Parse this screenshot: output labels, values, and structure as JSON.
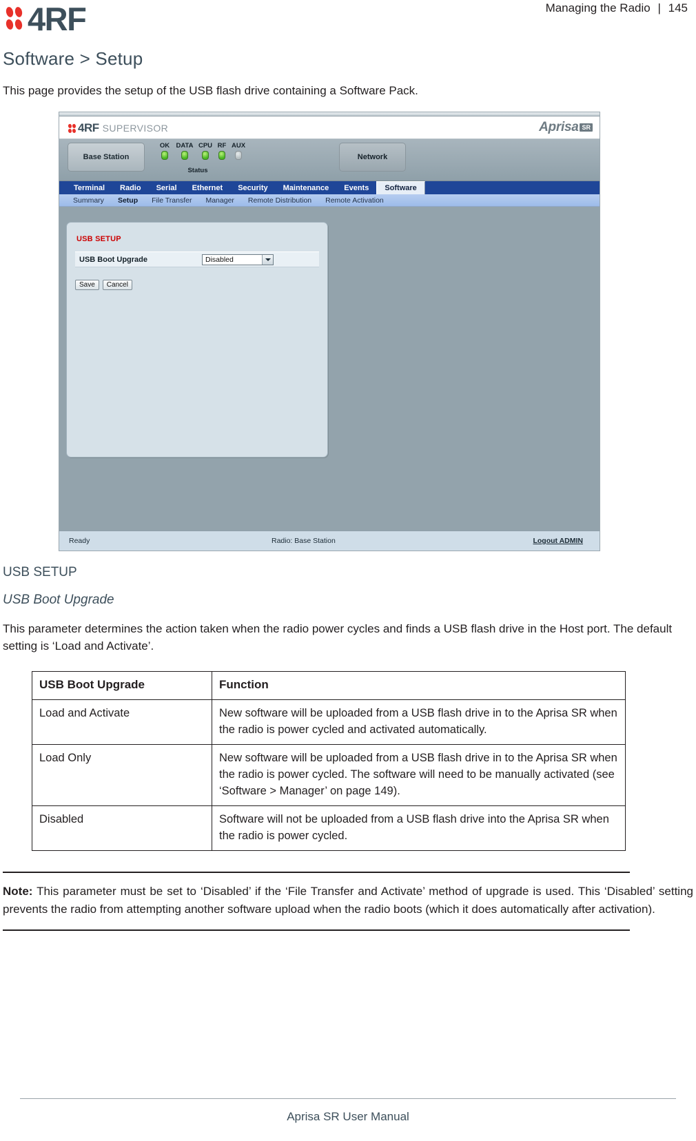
{
  "header": {
    "brand_word": "4RF",
    "running_head": "Managing the Radio",
    "separator": "|",
    "page_number": "145"
  },
  "page": {
    "title": "Software > Setup",
    "intro": "This page provides the setup of the USB flash drive containing a Software Pack.",
    "section_heading": "USB SETUP",
    "parameter_heading": "USB Boot Upgrade",
    "parameter_description": "This parameter determines the action taken when the radio power cycles and finds a USB flash drive in the Host port. The default setting is ‘Load and Activate’.",
    "note_label": "Note:",
    "note_text": "This parameter must be set to ‘Disabled’ if the ‘File Transfer and Activate’ method of upgrade is used. This ‘Disabled’ setting prevents the radio from attempting another software upload when the radio boots (which it does automatically after activation)."
  },
  "screenshot": {
    "brand": {
      "name": "4RF",
      "product": "SUPERVISOR",
      "right_logo": "Aprisa",
      "right_logo_badge": "SR"
    },
    "station_button": "Base Station",
    "network_button": "Network",
    "status_caption": "Status",
    "leds": [
      {
        "label": "OK",
        "state": "green"
      },
      {
        "label": "DATA",
        "state": "green"
      },
      {
        "label": "CPU",
        "state": "green"
      },
      {
        "label": "RF",
        "state": "green"
      },
      {
        "label": "AUX",
        "state": "off"
      }
    ],
    "nav_tabs": [
      {
        "label": "Terminal",
        "active": false
      },
      {
        "label": "Radio",
        "active": false
      },
      {
        "label": "Serial",
        "active": false
      },
      {
        "label": "Ethernet",
        "active": false
      },
      {
        "label": "Security",
        "active": false
      },
      {
        "label": "Maintenance",
        "active": false
      },
      {
        "label": "Events",
        "active": false
      },
      {
        "label": "Software",
        "active": true
      }
    ],
    "sub_tabs": [
      {
        "label": "Summary",
        "active": false
      },
      {
        "label": "Setup",
        "active": true
      },
      {
        "label": "File Transfer",
        "active": false
      },
      {
        "label": "Manager",
        "active": false
      },
      {
        "label": "Remote Distribution",
        "active": false
      },
      {
        "label": "Remote Activation",
        "active": false
      }
    ],
    "panel": {
      "title": "USB SETUP",
      "field_label": "USB Boot Upgrade",
      "field_value": "Disabled",
      "save_label": "Save",
      "cancel_label": "Cancel"
    },
    "footer": {
      "status": "Ready",
      "radio": "Radio: Base Station",
      "logout": "Logout ADMIN"
    }
  },
  "table": {
    "headers": [
      "USB Boot Upgrade",
      "Function"
    ],
    "rows": [
      {
        "option": "Load and Activate",
        "function": "New software will be uploaded from a USB flash drive in to the Aprisa SR when the radio is power cycled and activated automatically."
      },
      {
        "option": "Load Only",
        "function": "New software will be uploaded from a USB flash drive in to the Aprisa SR when the radio is power cycled. The software will need to be manually activated (see ‘Software > Manager’ on page 149)."
      },
      {
        "option": "Disabled",
        "function": "Software will not be uploaded from a USB flash drive into the Aprisa SR when the radio is power cycled."
      }
    ]
  },
  "footer": {
    "manual_title": "Aprisa SR User Manual"
  }
}
